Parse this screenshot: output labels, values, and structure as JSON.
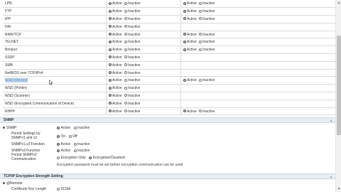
{
  "protocols": {
    "rows": [
      {
        "name": "LPR",
        "a": [
          "on",
          "off"
        ],
        "b": [
          "on",
          "off"
        ]
      },
      {
        "name": "FTP",
        "a": [
          "on",
          "off"
        ],
        "b": [
          "on",
          "off"
        ]
      },
      {
        "name": "IPP",
        "a": [
          "on",
          "off"
        ],
        "b": [
          "on",
          "off"
        ]
      },
      {
        "name": "HAI",
        "a": [
          "on",
          "off"
        ],
        "b": null
      },
      {
        "name": "RAW/TCP",
        "a": [
          "on",
          "off"
        ],
        "b": [
          "on",
          "off"
        ]
      },
      {
        "name": "TELNET",
        "a": [
          "on",
          "off"
        ],
        "b": [
          "on",
          "off"
        ]
      },
      {
        "name": "Bonjour",
        "a": [
          "on",
          "off"
        ],
        "b": [
          "on",
          "off"
        ]
      },
      {
        "name": "SSDP",
        "a": [
          "on",
          "off"
        ],
        "b": null
      },
      {
        "name": "SMB",
        "a": [
          "on",
          "off"
        ],
        "b": null
      },
      {
        "name": "NetBIOS over TCP/IPv4",
        "a": [
          "on",
          "off"
        ],
        "b": null
      },
      {
        "name": "WSD (Device)",
        "a": [
          "on",
          "off"
        ],
        "b": [
          "on",
          "off"
        ],
        "highlight": true
      },
      {
        "name": "WSD (Printer)",
        "a": [
          "on",
          "off"
        ],
        "b": null
      },
      {
        "name": "WSD (Scanner)",
        "a": [
          "on",
          "off"
        ],
        "b": null
      },
      {
        "name": "WSD (Encrypted Communication of Device)",
        "a": [
          "on",
          "off"
        ],
        "b": null
      },
      {
        "name": "RHPP",
        "a": [
          "on",
          "off"
        ],
        "b": [
          "on",
          "off"
        ]
      }
    ],
    "active_label": "Active",
    "inactive_label": "Inactive"
  },
  "snmp": {
    "title": "SNMP",
    "snmp_label": "SNMP",
    "snmp_active": "Active",
    "snmp_inactive": "Inactive",
    "permit_v1v2_label": "Permit Settings by SNMPv1 and v2",
    "permit_on": "On",
    "permit_off": "Off",
    "v1v2_function_label": "SNMPv1,v2 Function",
    "v1v2_active": "Active",
    "v1v2_inactive": "Inactive",
    "v3_function_label": "SNMPv3 Function",
    "v3_active": "Active",
    "v3_inactive": "Inactive",
    "permit_v3_label": "Permit SNMPv3 Communication",
    "encryption_only": "Encryption Only",
    "encryption_cleartext": "Encryption/Cleartext",
    "note": "Encryption password must be set before encryption communication can be used."
  },
  "tcpip": {
    "title": "TCP/IP Encryption Strength Setting",
    "remote_label": "@Remote",
    "cert_key_label": "Certificate Key Length",
    "cert_key_value": "512bit"
  }
}
